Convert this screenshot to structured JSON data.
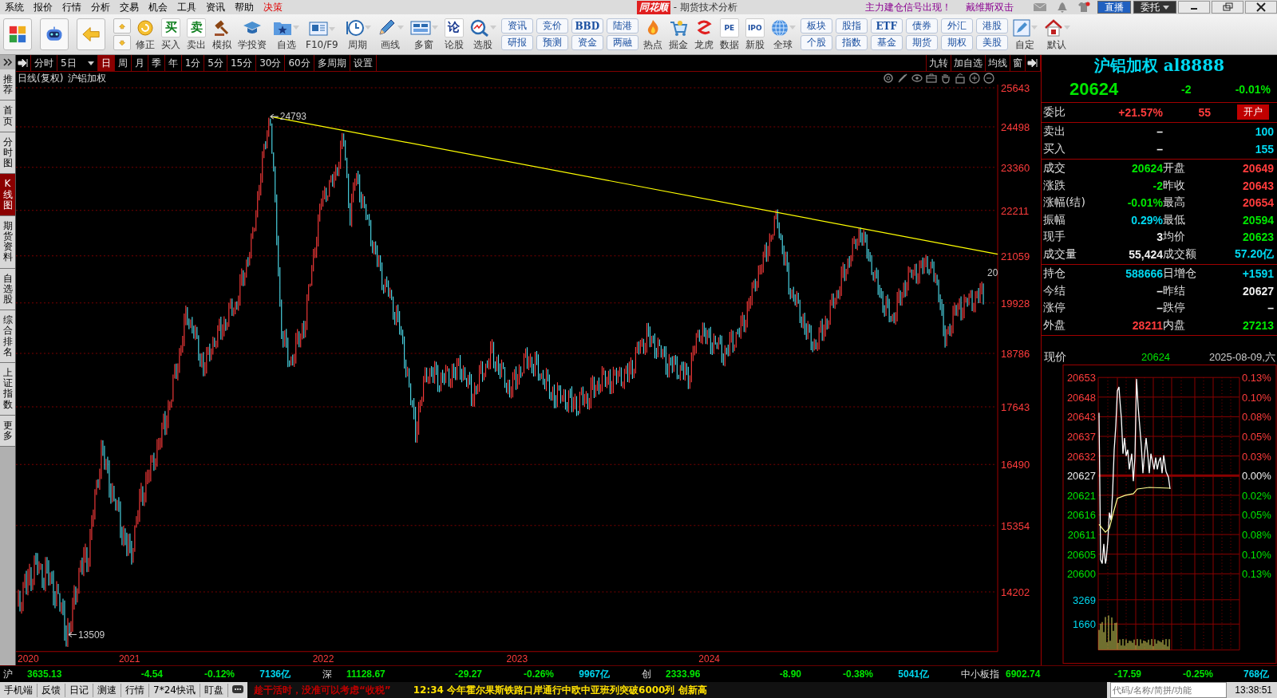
{
  "menu": [
    {
      "label": "系统",
      "highlight": false
    },
    {
      "label": "报价",
      "highlight": false
    },
    {
      "label": "行情",
      "highlight": false
    },
    {
      "label": "分析",
      "highlight": false
    },
    {
      "label": "交易",
      "highlight": false
    },
    {
      "label": "机会",
      "highlight": false
    },
    {
      "label": "工具",
      "highlight": false
    },
    {
      "label": "资讯",
      "highlight": false
    },
    {
      "label": "帮助",
      "highlight": false
    },
    {
      "label": "决策",
      "highlight": true
    }
  ],
  "title": {
    "logo": "同花顺",
    "text": "- 期货技术分析"
  },
  "notices": [
    "主力建仓信号出现！",
    "戴维斯双击"
  ],
  "top_buttons": [
    {
      "label": "直播",
      "kind": "live"
    },
    {
      "label": "委托",
      "kind": "trade"
    }
  ],
  "toolbar": [
    {
      "kind": "icon"
    },
    {
      "kind": "icon"
    },
    {
      "kind": "icon"
    },
    {
      "kind": "updown"
    },
    {
      "kind": "labeled",
      "label": "修正",
      "dropdown": false
    },
    {
      "kind": "labeled",
      "label": "买入",
      "glyph": "买",
      "dropdown": false
    },
    {
      "kind": "labeled",
      "label": "卖出",
      "glyph": "卖",
      "dropdown": false
    },
    {
      "kind": "labeled",
      "label": "模拟",
      "dropdown": false
    },
    {
      "kind": "labeled",
      "label": "学投资",
      "dropdown": false
    },
    {
      "kind": "labeled",
      "label": "自选",
      "dropdown": true
    },
    {
      "kind": "labeled",
      "label": "F10/F9",
      "dropdown": true
    },
    {
      "kind": "labeled",
      "label": "周期",
      "dropdown": true
    },
    {
      "kind": "labeled",
      "label": "画线",
      "dropdown": true
    },
    {
      "kind": "labeled",
      "label": "多窗",
      "dropdown": true
    },
    {
      "kind": "labeled",
      "label": "论股",
      "glyph": "论",
      "dropdown": false
    },
    {
      "kind": "labeled",
      "label": "选股",
      "dropdown": true
    },
    {
      "kind": "pair",
      "top": "资讯",
      "bottom": "研报"
    },
    {
      "kind": "pair",
      "top": "竞价",
      "bottom": "预测"
    },
    {
      "kind": "pair",
      "top": "BBD",
      "bottom": "资金"
    },
    {
      "kind": "pair",
      "top": "陆港",
      "bottom": "两融"
    },
    {
      "kind": "labeled",
      "label": "热点",
      "dropdown": false
    },
    {
      "kind": "labeled",
      "label": "掘金",
      "dropdown": false
    },
    {
      "kind": "labeled",
      "label": "龙虎",
      "dropdown": false
    },
    {
      "kind": "labeled",
      "label": "数据",
      "glyph": "PE",
      "dropdown": false
    },
    {
      "kind": "labeled",
      "label": "新股",
      "glyph": "IPO",
      "dropdown": false
    },
    {
      "kind": "labeled",
      "label": "全球",
      "dropdown": true
    },
    {
      "kind": "pair",
      "top": "板块",
      "bottom": "个股"
    },
    {
      "kind": "pair",
      "top": "股指",
      "bottom": "指数"
    },
    {
      "kind": "pair",
      "top": "ETF",
      "bottom": "基金"
    },
    {
      "kind": "pair",
      "top": "债券",
      "bottom": "期货"
    },
    {
      "kind": "pair",
      "top": "外汇",
      "bottom": "期权"
    },
    {
      "kind": "pair",
      "top": "港股",
      "bottom": "美股"
    },
    {
      "kind": "labeled",
      "label": "自定",
      "dropdown": true
    },
    {
      "kind": "labeled",
      "label": "默认",
      "dropdown": true
    }
  ],
  "side_tabs": [
    {
      "label": "推荐",
      "selected": false
    },
    {
      "label": "首页",
      "selected": false
    },
    {
      "label": "分时图",
      "selected": false
    },
    {
      "label": "K线图",
      "selected": true
    },
    {
      "label": "期货资料",
      "selected": false
    },
    {
      "label": "自选股",
      "selected": false
    },
    {
      "label": "综合排名",
      "selected": false
    },
    {
      "label": "上证指数",
      "selected": false
    },
    {
      "label": "更多",
      "selected": false
    }
  ],
  "periods": [
    {
      "label": "分时",
      "selected": false,
      "dropdown": false
    },
    {
      "label": "5日",
      "selected": false,
      "dropdown": true
    },
    {
      "label": "日",
      "selected": true,
      "dropdown": false
    },
    {
      "label": "周",
      "selected": false,
      "dropdown": false
    },
    {
      "label": "月",
      "selected": false,
      "dropdown": false
    },
    {
      "label": "季",
      "selected": false,
      "dropdown": false
    },
    {
      "label": "年",
      "selected": false,
      "dropdown": false
    },
    {
      "label": "1分",
      "selected": false,
      "dropdown": false
    },
    {
      "label": "5分",
      "selected": false,
      "dropdown": false
    },
    {
      "label": "15分",
      "selected": false,
      "dropdown": false
    },
    {
      "label": "30分",
      "selected": false,
      "dropdown": false
    },
    {
      "label": "60分",
      "selected": false,
      "dropdown": false
    },
    {
      "label": "多周期",
      "selected": false,
      "dropdown": false
    },
    {
      "label": "设置",
      "selected": false,
      "dropdown": false
    }
  ],
  "chart_tools": [
    "九转",
    "加自选",
    "均线",
    "窗"
  ],
  "chart": {
    "title": "日线(复权)",
    "name": "沪铝加权",
    "y_labels": [
      "25643",
      "24498",
      "23360",
      "22211",
      "21059",
      "19928",
      "18786",
      "17643",
      "16490",
      "15354",
      "14202"
    ],
    "x_labels": [
      "2020",
      "2021",
      "2022",
      "2023",
      "2024"
    ],
    "high_label": "24793",
    "low_label": "13509",
    "last_label": "20"
  },
  "quote": {
    "name": "沪铝加权 al8888",
    "price": "20624",
    "change": "-2",
    "percent": "-0.01%",
    "weibi": {
      "label": "委比",
      "value": "+21.57%",
      "diff": "55",
      "button": "开户"
    },
    "book": [
      {
        "label": "卖出",
        "price": "–",
        "volume": "100"
      },
      {
        "label": "买入",
        "price": "–",
        "volume": "155"
      }
    ],
    "stats": [
      {
        "cells": [
          {
            "label": "成交",
            "value": "20624",
            "color": "#00e600"
          },
          {
            "label": "开盘",
            "value": "20649",
            "color": "#ff3c3c"
          }
        ]
      },
      {
        "cells": [
          {
            "label": "涨跌",
            "value": "-2",
            "color": "#00e600"
          },
          {
            "label": "昨收",
            "value": "20643",
            "color": "#ff3c3c"
          }
        ]
      },
      {
        "cells": [
          {
            "label": "涨幅(结)",
            "value": "-0.01%",
            "color": "#00e600"
          },
          {
            "label": "最高",
            "value": "20654",
            "color": "#ff3c3c"
          }
        ]
      },
      {
        "cells": [
          {
            "label": "振幅",
            "value": "0.29%",
            "color": "#00d8f0"
          },
          {
            "label": "最低",
            "value": "20594",
            "color": "#00e600"
          }
        ]
      },
      {
        "cells": [
          {
            "label": "现手",
            "value": "3",
            "color": "#f0f0f0"
          },
          {
            "label": "均价",
            "value": "20623",
            "color": "#00e600"
          }
        ]
      },
      {
        "cells": [
          {
            "label": "成交量",
            "value": "55,424",
            "color": "#f0f0f0"
          },
          {
            "label": "成交额",
            "value": "57.20亿",
            "color": "#00d8f0"
          }
        ]
      }
    ],
    "stats2": [
      {
        "cells": [
          {
            "label": "持仓",
            "value": "588666",
            "color": "#00d8f0"
          },
          {
            "label": "日增仓",
            "value": "+1591",
            "color": "#00d8f0"
          }
        ]
      },
      {
        "cells": [
          {
            "label": "今结",
            "value": "–",
            "color": "#f0f0f0"
          },
          {
            "label": "昨结",
            "value": "20627",
            "color": "#f0f0f0"
          }
        ]
      },
      {
        "cells": [
          {
            "label": "涨停",
            "value": "–",
            "color": "#f0f0f0"
          },
          {
            "label": "跌停",
            "value": "–",
            "color": "#f0f0f0"
          }
        ]
      },
      {
        "cells": [
          {
            "label": "外盘",
            "value": "28211",
            "color": "#ff3c3c"
          },
          {
            "label": "内盘",
            "value": "27213",
            "color": "#00e600"
          }
        ]
      }
    ]
  },
  "intraday": {
    "label": "现价",
    "price": "20624",
    "date": "2025-08-09,六",
    "left": [
      {
        "text": "20653",
        "color": "#ff3c3c"
      },
      {
        "text": "20648",
        "color": "#ff3c3c"
      },
      {
        "text": "20643",
        "color": "#ff3c3c"
      },
      {
        "text": "20637",
        "color": "#ff3c3c"
      },
      {
        "text": "20632",
        "color": "#ff3c3c"
      },
      {
        "text": "20627",
        "color": "#f0f0f0"
      },
      {
        "text": "20621",
        "color": "#00e600"
      },
      {
        "text": "20616",
        "color": "#00e600"
      },
      {
        "text": "20611",
        "color": "#00e600"
      },
      {
        "text": "20605",
        "color": "#00e600"
      },
      {
        "text": "20600",
        "color": "#00e600"
      }
    ],
    "right": [
      {
        "text": "0.13%",
        "color": "#ff3c3c"
      },
      {
        "text": "0.10%",
        "color": "#ff3c3c"
      },
      {
        "text": "0.08%",
        "color": "#ff3c3c"
      },
      {
        "text": "0.05%",
        "color": "#ff3c3c"
      },
      {
        "text": "0.03%",
        "color": "#ff3c3c"
      },
      {
        "text": "0.00%",
        "color": "#f0f0f0"
      },
      {
        "text": "0.02%",
        "color": "#00e600"
      },
      {
        "text": "0.05%",
        "color": "#00e600"
      },
      {
        "text": "0.08%",
        "color": "#00e600"
      },
      {
        "text": "0.10%",
        "color": "#00e600"
      },
      {
        "text": "0.13%",
        "color": "#00e600"
      }
    ],
    "volume_labels": [
      "3269",
      "1660"
    ]
  },
  "indices": [
    {
      "name": "沪",
      "value": "3635.13",
      "change": "-4.54",
      "percent": "-0.12%",
      "amount": "7136亿"
    },
    {
      "name": "深",
      "value": "11128.67",
      "change": "-29.27",
      "percent": "-0.26%",
      "amount": "9967亿"
    },
    {
      "name": "创",
      "value": "2333.96",
      "change": "-8.90",
      "percent": "-0.38%",
      "amount": "5041亿"
    },
    {
      "name": "中小板指",
      "value": "6902.74",
      "change": "-17.59",
      "percent": "-0.25%",
      "amount": "768亿"
    }
  ],
  "status": {
    "links": [
      "手机端",
      "反馈",
      "日记",
      "测速",
      "行情",
      "7*24快讯",
      "盯盘"
    ],
    "tip": "趁干活时，没准可以考虑“收税”",
    "news": "12:34 今年霍尔果斯铁路口岸通行中欧中亚班列突破6000列 创新高",
    "search": {
      "placeholder": "代码/名称/简拼/功能"
    },
    "time": "13:38:51"
  }
}
